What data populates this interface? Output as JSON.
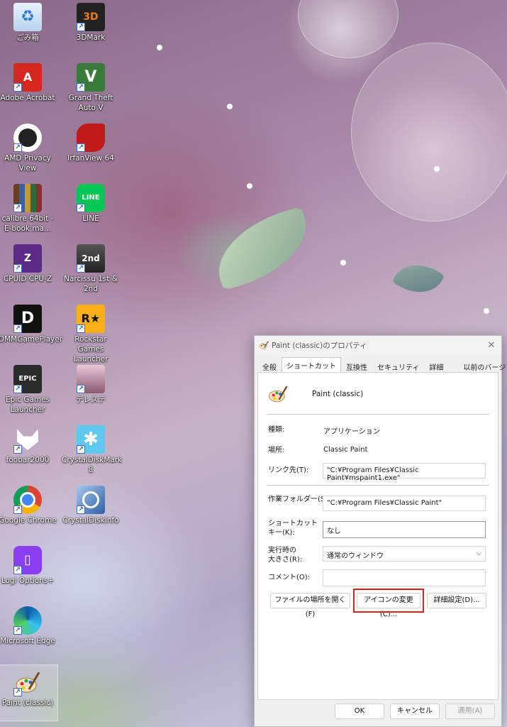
{
  "desktop": {
    "icons": [
      {
        "label": "ごみ箱",
        "icon": "recycle-bin-icon"
      },
      {
        "label": "3DMark",
        "icon": "3dmark-icon"
      },
      {
        "label": "Adobe Acrobat",
        "icon": "acrobat-icon"
      },
      {
        "label": "Grand Theft Auto V",
        "icon": "gta-icon"
      },
      {
        "label": "AMD Privacy View",
        "icon": "amd-privacy-icon"
      },
      {
        "label": "IrfanView 64",
        "icon": "irfanview-icon"
      },
      {
        "label": "calibre 64bit - E-book ma...",
        "icon": "calibre-icon"
      },
      {
        "label": "LINE",
        "icon": "line-icon"
      },
      {
        "label": "CPUID CPU-Z",
        "icon": "cpuz-icon"
      },
      {
        "label": "Narcissu 1st & 2nd",
        "icon": "narcissu-icon"
      },
      {
        "label": "DMMGamePlayer",
        "icon": "dmm-icon"
      },
      {
        "label": "Rockstar Games Launcher",
        "icon": "rockstar-icon"
      },
      {
        "label": "Epic Games Launcher",
        "icon": "epic-icon"
      },
      {
        "label": "デレステ",
        "icon": "dereste-icon"
      },
      {
        "label": "foobar2000",
        "icon": "foobar-icon"
      },
      {
        "label": "CrystalDiskMark 8",
        "icon": "crystaldiskmark-icon"
      },
      {
        "label": "Google Chrome",
        "icon": "chrome-icon"
      },
      {
        "label": "CrystalDiskInfo",
        "icon": "crystaldiskinfo-icon"
      },
      {
        "label": "Logi Options+",
        "icon": "logi-icon"
      },
      {
        "label": "Microsoft Edge",
        "icon": "edge-icon"
      },
      {
        "label": "Paint (classic)",
        "icon": "paint-icon"
      }
    ],
    "glyphs": {
      "threedmark": "3D",
      "acrobat": "A",
      "gta": "V",
      "line": "LINE",
      "cpuz": "Z",
      "narcissu": "2nd",
      "dmm": "D",
      "rockstar": "R★",
      "epic": "EPIC",
      "crystaldiskmark": "✱",
      "logi": "▯"
    }
  },
  "dialog": {
    "title": "Paint (classic)のプロパティ",
    "close": "✕",
    "tabs": [
      "全般",
      "ショートカット",
      "互換性",
      "セキュリティ",
      "詳細",
      "以前のバージョン"
    ],
    "active_tab": "ショートカット",
    "app_name": "Paint (classic)",
    "fields": {
      "type_label": "種類:",
      "type_value": "アプリケーション",
      "location_label": "場所:",
      "location_value": "Classic Paint",
      "target_label": "リンク先(T):",
      "target_value": "\"C:¥Program Files¥Classic Paint¥mspaint1.exe\"",
      "workdir_label": "作業フォルダー(S):",
      "workdir_value": "\"C:¥Program Files¥Classic Paint\"",
      "shortcut_label_1": "ショートカット",
      "shortcut_label_2": "キー(K):",
      "shortcut_value": "なし",
      "run_label_1": "実行時の",
      "run_label_2": "大きさ(R):",
      "run_value": "通常のウィンドウ",
      "run_chevron": "⌵",
      "comment_label": "コメント(O):",
      "comment_value": ""
    },
    "buttons": {
      "open_location": "ファイルの場所を開く(F)",
      "change_icon": "アイコンの変更(C)...",
      "advanced": "詳細設定(D)...",
      "ok": "OK",
      "cancel": "キャンセル",
      "apply": "適用(A)"
    },
    "highlight_color": "#e0201f"
  }
}
